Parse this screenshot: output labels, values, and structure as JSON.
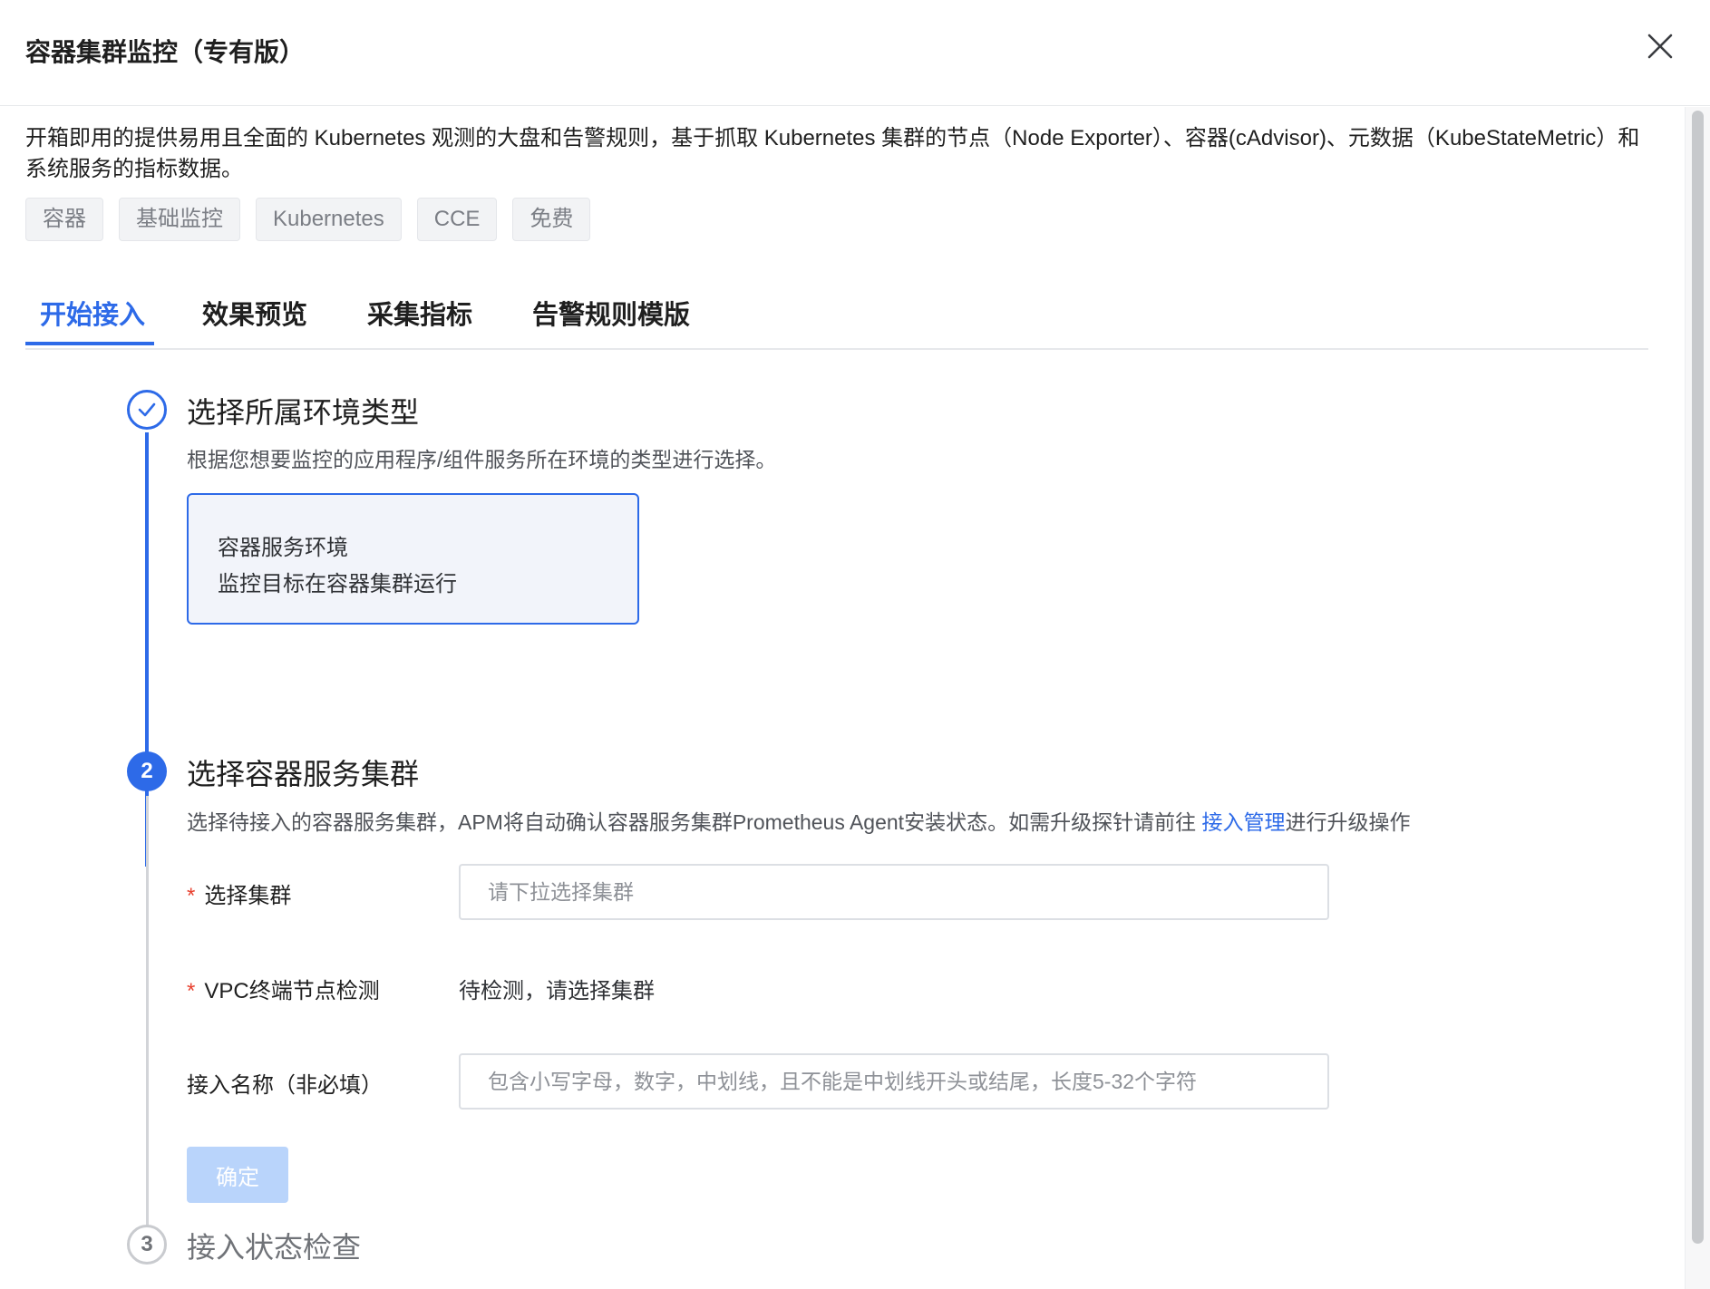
{
  "window": {
    "title": "容器集群监控（专有版）"
  },
  "intro": {
    "description": "开箱即用的提供易用且全面的 Kubernetes 观测的大盘和告警规则，基于抓取 Kubernetes 集群的节点（Node Exporter）、容器(cAdvisor)、元数据（KubeStateMetric）和系统服务的指标数据。",
    "tags": [
      "容器",
      "基础监控",
      "Kubernetes",
      "CCE",
      "免费"
    ]
  },
  "tabs": [
    {
      "label": "开始接入",
      "active": true
    },
    {
      "label": "效果预览",
      "active": false
    },
    {
      "label": "采集指标",
      "active": false
    },
    {
      "label": "告警规则模版",
      "active": false
    }
  ],
  "steps": {
    "step1": {
      "title": "选择所属环境类型",
      "description": "根据您想要监控的应用程序/组件服务所在环境的类型进行选择。",
      "status": "done",
      "option_card": {
        "name": "容器服务环境",
        "detail": "监控目标在容器集群运行"
      }
    },
    "step2": {
      "number": "2",
      "title": "选择容器服务集群",
      "description_prefix": "选择待接入的容器服务集群，APM将自动确认容器服务集群Prometheus Agent安装状态。如需升级探针请前往 ",
      "description_link": "接入管理",
      "description_suffix": "进行升级操作",
      "status": "active"
    },
    "step3": {
      "number": "3",
      "title": "接入状态检查",
      "status": "pending"
    }
  },
  "form": {
    "required_mark": "*",
    "cluster": {
      "label": "选择集群",
      "placeholder": "请下拉选择集群",
      "value": ""
    },
    "vpc_check": {
      "label": "VPC终端节点检测",
      "status_text": "待检测，请选择集群"
    },
    "access_name": {
      "label": "接入名称（非必填）",
      "placeholder": "包含小写字母，数字，中划线，且不能是中划线开头或结尾，长度5-32个字符",
      "value": ""
    },
    "confirm_label": "确定"
  },
  "colors": {
    "primary": "#2d6ae8",
    "disabled_button": "#b9d4fb",
    "required": "#e8412f"
  }
}
